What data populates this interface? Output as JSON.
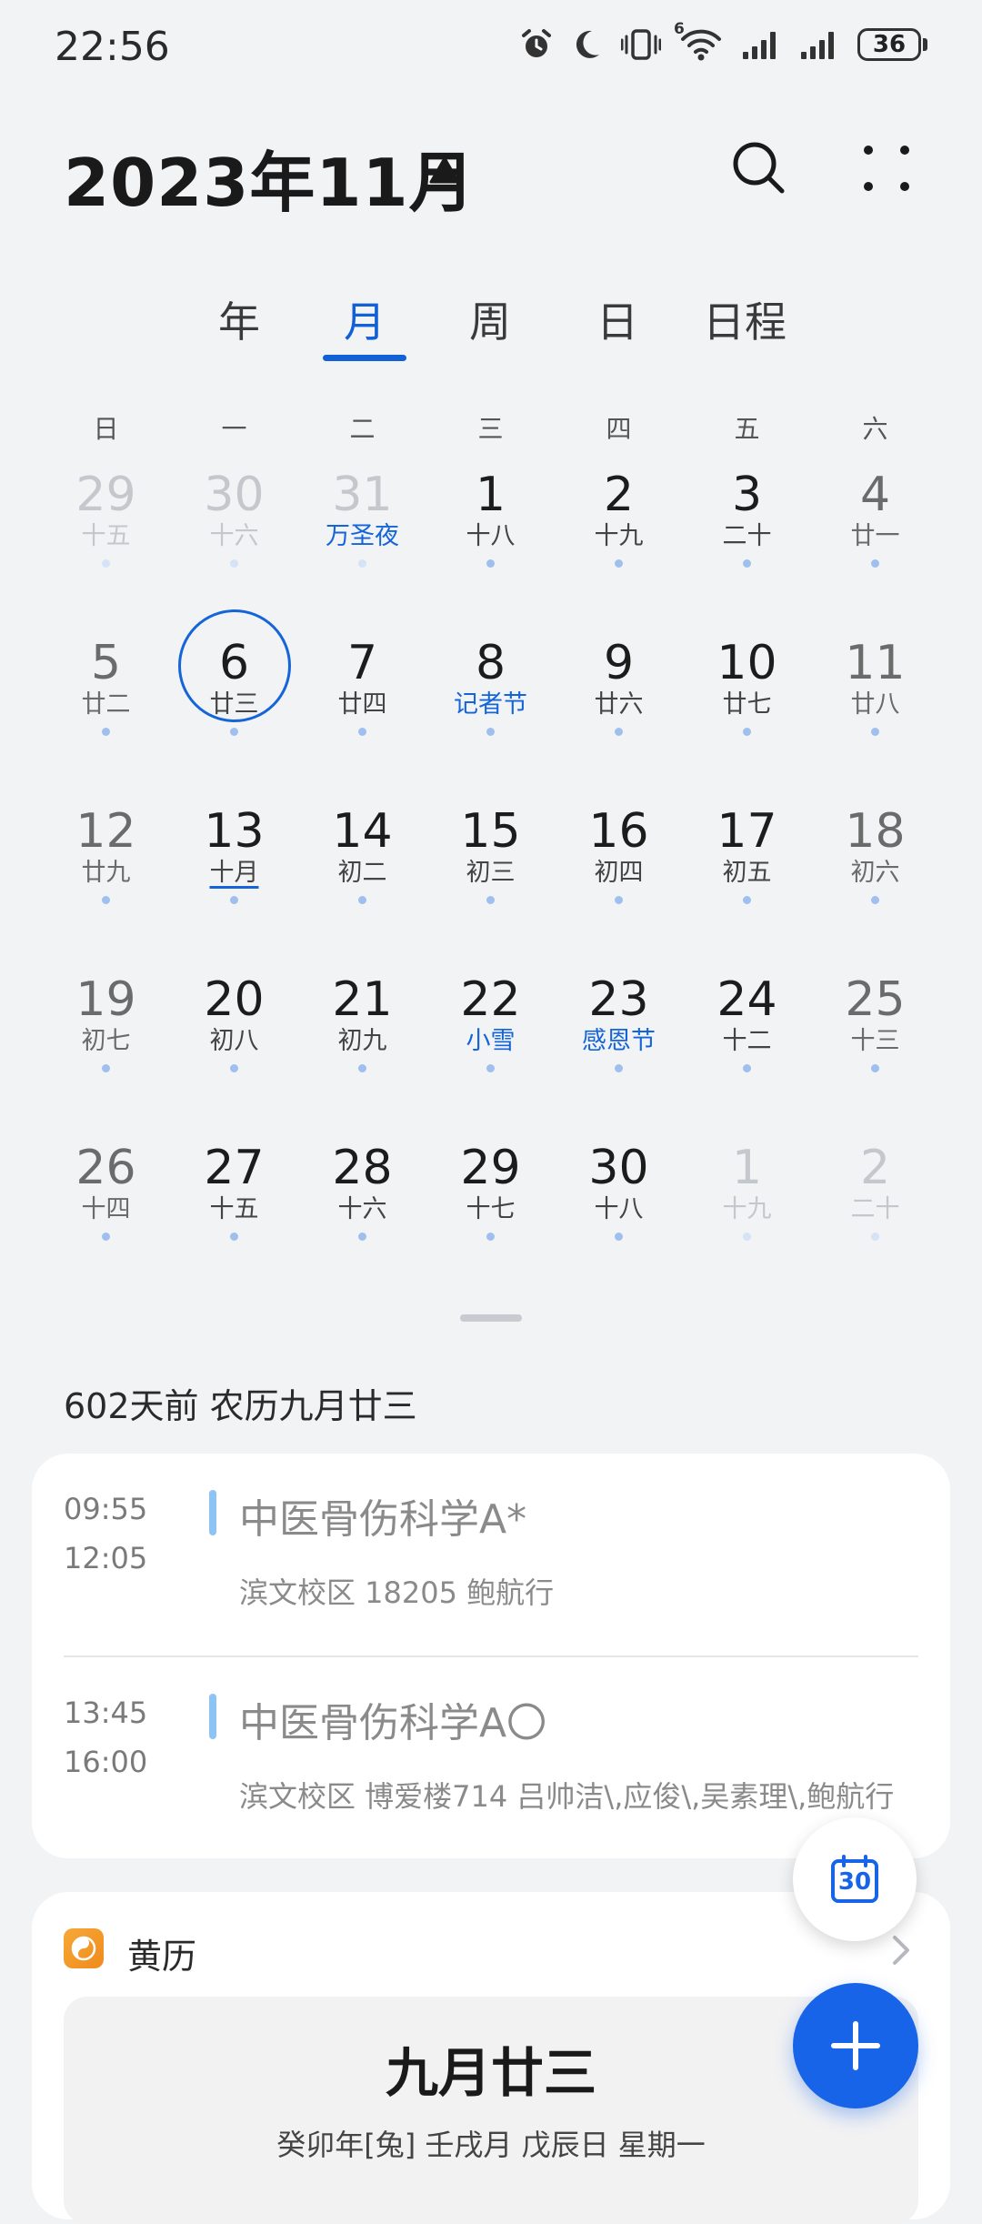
{
  "status_bar": {
    "time": "22:56",
    "battery": "36",
    "wifi_badge": "6",
    "icons": [
      "alarm-icon",
      "moon-icon",
      "vibrate-icon",
      "wifi-icon",
      "signal-icon",
      "signal-icon",
      "battery-icon"
    ]
  },
  "header": {
    "title": "2023年11月",
    "icons": [
      "caret-up-icon",
      "search-icon",
      "more-icon"
    ]
  },
  "tabs": [
    {
      "label": "年",
      "active": false
    },
    {
      "label": "月",
      "active": true
    },
    {
      "label": "周",
      "active": false
    },
    {
      "label": "日",
      "active": false
    },
    {
      "label": "日程",
      "active": false
    }
  ],
  "weekdays": [
    "日",
    "一",
    "二",
    "三",
    "四",
    "五",
    "六"
  ],
  "weeks": [
    [
      {
        "day": "29",
        "lunar": "十五",
        "other": true
      },
      {
        "day": "30",
        "lunar": "十六",
        "other": true
      },
      {
        "day": "31",
        "lunar": "万圣夜",
        "other": true,
        "festival": true
      },
      {
        "day": "1",
        "lunar": "十八"
      },
      {
        "day": "2",
        "lunar": "十九"
      },
      {
        "day": "3",
        "lunar": "二十"
      },
      {
        "day": "4",
        "lunar": "廿一"
      }
    ],
    [
      {
        "day": "5",
        "lunar": "廿二"
      },
      {
        "day": "6",
        "lunar": "廿三",
        "today": true
      },
      {
        "day": "7",
        "lunar": "廿四"
      },
      {
        "day": "8",
        "lunar": "记者节",
        "festival": true
      },
      {
        "day": "9",
        "lunar": "廿六"
      },
      {
        "day": "10",
        "lunar": "廿七"
      },
      {
        "day": "11",
        "lunar": "廿八"
      }
    ],
    [
      {
        "day": "12",
        "lunar": "廿九"
      },
      {
        "day": "13",
        "lunar": "十月",
        "underline": true
      },
      {
        "day": "14",
        "lunar": "初二"
      },
      {
        "day": "15",
        "lunar": "初三"
      },
      {
        "day": "16",
        "lunar": "初四"
      },
      {
        "day": "17",
        "lunar": "初五"
      },
      {
        "day": "18",
        "lunar": "初六"
      }
    ],
    [
      {
        "day": "19",
        "lunar": "初七"
      },
      {
        "day": "20",
        "lunar": "初八"
      },
      {
        "day": "21",
        "lunar": "初九"
      },
      {
        "day": "22",
        "lunar": "小雪",
        "festival": true
      },
      {
        "day": "23",
        "lunar": "感恩节",
        "festival": true
      },
      {
        "day": "24",
        "lunar": "十二"
      },
      {
        "day": "25",
        "lunar": "十三"
      }
    ],
    [
      {
        "day": "26",
        "lunar": "十四"
      },
      {
        "day": "27",
        "lunar": "十五"
      },
      {
        "day": "28",
        "lunar": "十六"
      },
      {
        "day": "29",
        "lunar": "十七"
      },
      {
        "day": "30",
        "lunar": "十八"
      },
      {
        "day": "1",
        "lunar": "十九",
        "other": true
      },
      {
        "day": "2",
        "lunar": "二十",
        "other": true
      }
    ]
  ],
  "info_line": "602天前 农历九月廿三",
  "events": [
    {
      "start": "09:55",
      "end": "12:05",
      "title": "中医骨伤科学A*",
      "subtitle": "滨文校区 18205 鲍航行"
    },
    {
      "start": "13:45",
      "end": "16:00",
      "title": "中医骨伤科学A〇",
      "subtitle": "滨文校区 博爱楼714 吕帅洁\\,应俊\\,吴素理\\,鲍航行"
    }
  ],
  "huangli": {
    "title": "黄历",
    "date": "九月廿三",
    "ganzhi": "癸卯年[兔]   壬戌月 戊辰日 星期一"
  },
  "fab": {
    "today_label": "30"
  },
  "colors": {
    "accent": "#1260d6",
    "background": "#f1f3f5",
    "event_bar": "#8ec4f3",
    "fab": "#1764e8"
  }
}
